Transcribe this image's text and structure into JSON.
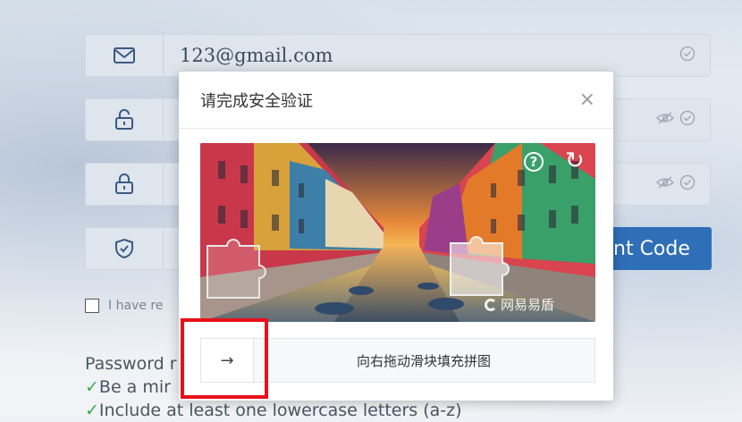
{
  "form": {
    "email_value": "123@gmail.com",
    "password_mask": "•",
    "confirm_mask": "•",
    "code_placeholder": "|",
    "send_code_label": "nt Code",
    "agree_text": "I have re",
    "password_rules_title": "Password r",
    "rule_1": "Be a mir",
    "rule_2": "Include at least one lowercase letters (a-z)",
    "rule_check": "✓"
  },
  "captcha": {
    "title": "请完成安全验证",
    "close_glyph": "×",
    "help_glyph": "?",
    "refresh_glyph": "↻",
    "brand": "网易易盾",
    "slider_arrow": "→",
    "slider_hint": "向右拖动滑块填充拼图"
  }
}
